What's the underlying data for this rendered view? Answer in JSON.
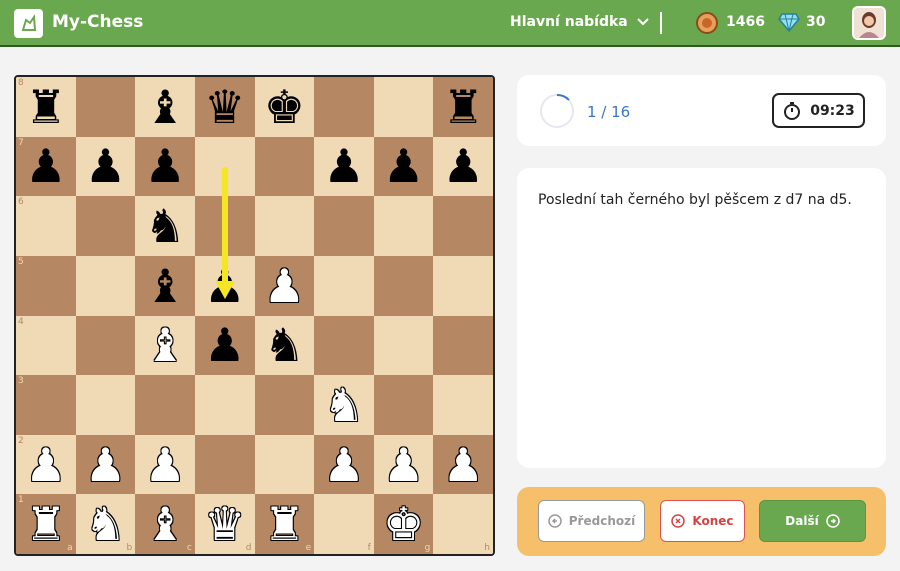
{
  "header": {
    "brand": "My-Chess",
    "menu_label": "Hlavní nabídka",
    "coins": "1466",
    "gems": "30",
    "colors": {
      "bar": "#6aa84f"
    }
  },
  "board": {
    "files": [
      "a",
      "b",
      "c",
      "d",
      "e",
      "f",
      "g",
      "h"
    ],
    "ranks": [
      "8",
      "7",
      "6",
      "5",
      "4",
      "3",
      "2",
      "1"
    ],
    "position": [
      [
        "br",
        "",
        "bb",
        "bq",
        "bk",
        "",
        "",
        "br"
      ],
      [
        "bp",
        "bp",
        "bp",
        "",
        "",
        "bp",
        "bp",
        "bp"
      ],
      [
        "",
        "",
        "bn",
        "",
        "",
        "",
        "",
        ""
      ],
      [
        "",
        "",
        "bb",
        "bp",
        "wp",
        "",
        "",
        ""
      ],
      [
        "",
        "",
        "wb",
        "bp",
        "bn",
        "",
        "",
        ""
      ],
      [
        "",
        "",
        "",
        "",
        "",
        "wn",
        "",
        ""
      ],
      [
        "wp",
        "wp",
        "wp",
        "",
        "",
        "wp",
        "wp",
        "wp"
      ],
      [
        "wr",
        "wn",
        "wb",
        "wq",
        "wr",
        "",
        "wk",
        ""
      ]
    ],
    "last_move": {
      "from": "d7",
      "to": "d5",
      "arrow_color": "#f5e623"
    }
  },
  "status": {
    "progress": "1 / 16",
    "timer": "09:23"
  },
  "description": "Poslední tah černého byl pěšcem z d7 na d5.",
  "actions": {
    "prev_label": "Předchozí",
    "end_label": "Konec",
    "next_label": "Další"
  }
}
